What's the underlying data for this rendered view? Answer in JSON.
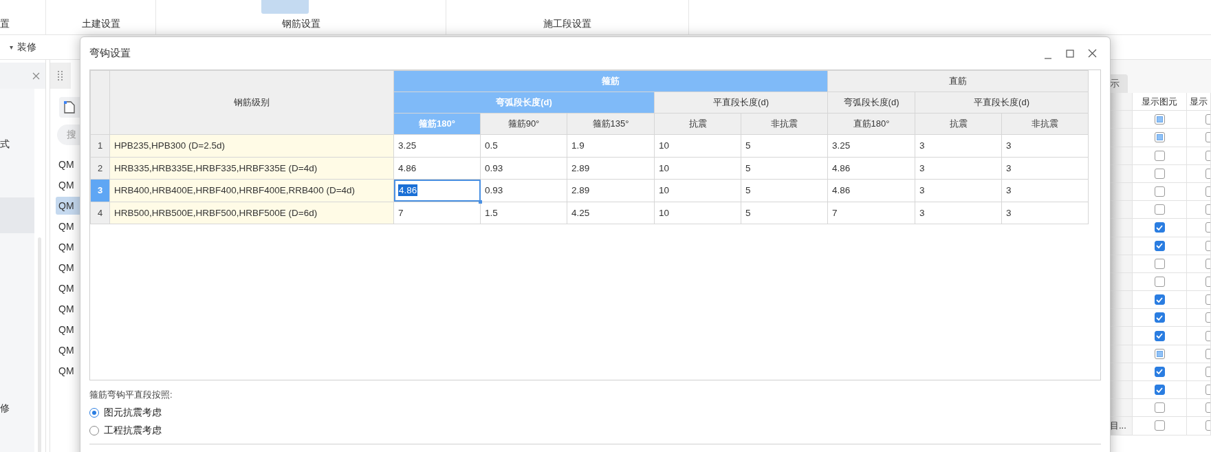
{
  "ribbon": {
    "groups": [
      {
        "label": "置"
      },
      {
        "label": "土建设置"
      },
      {
        "label": "钢筋设置"
      },
      {
        "label": "施工段设置"
      }
    ]
  },
  "toolbar": {
    "caret": "▾",
    "label": "装修"
  },
  "left_panel": {
    "items": [
      {
        "text": "式",
        "selected": false
      },
      {
        "selected": true
      },
      {
        "text": "修",
        "selected": false
      }
    ]
  },
  "list_panel": {
    "search": {
      "placeholder": "搜"
    },
    "items": [
      {
        "text": "QM",
        "selected": false
      },
      {
        "text": "QM",
        "selected": false
      },
      {
        "text": "QM",
        "selected": true
      },
      {
        "text": "QM",
        "selected": false
      },
      {
        "text": "QM",
        "selected": false
      },
      {
        "text": "QM",
        "selected": false
      },
      {
        "text": "QM",
        "selected": false
      },
      {
        "text": "QM",
        "selected": false
      },
      {
        "text": "QM",
        "selected": false
      },
      {
        "text": "QM",
        "selected": false
      },
      {
        "text": "QM",
        "selected": false
      }
    ]
  },
  "right_panel": {
    "tab": "示",
    "columns": [
      "显示图元",
      "显示"
    ],
    "rows": [
      {
        "checks": [
          {
            "checked": false,
            "partial": true
          },
          {
            "checked": false
          }
        ]
      },
      {
        "checks": [
          {
            "checked": false,
            "partial": true
          },
          {
            "checked": false
          }
        ]
      },
      {
        "checks": [
          {
            "checked": false
          },
          {
            "checked": false
          }
        ]
      },
      {
        "checks": [
          {
            "checked": false
          },
          {
            "checked": false
          }
        ]
      },
      {
        "checks": [
          {
            "checked": false
          },
          {
            "checked": false
          }
        ]
      },
      {
        "checks": [
          {
            "checked": false
          },
          {
            "checked": false
          }
        ]
      },
      {
        "checks": [
          {
            "checked": true
          },
          {
            "checked": false
          }
        ]
      },
      {
        "checks": [
          {
            "checked": true
          },
          {
            "checked": false
          }
        ]
      },
      {
        "checks": [
          {
            "checked": false
          },
          {
            "checked": false
          }
        ]
      },
      {
        "checks": [
          {
            "checked": false
          },
          {
            "checked": false
          }
        ]
      },
      {
        "checks": [
          {
            "checked": true
          },
          {
            "checked": false
          }
        ]
      },
      {
        "checks": [
          {
            "checked": true
          },
          {
            "checked": false
          }
        ]
      },
      {
        "checks": [
          {
            "checked": true
          },
          {
            "checked": false
          }
        ]
      },
      {
        "checks": [
          {
            "checked": false,
            "partial": true
          },
          {
            "checked": false
          }
        ]
      },
      {
        "checks": [
          {
            "checked": true
          },
          {
            "checked": false
          }
        ]
      },
      {
        "checks": [
          {
            "checked": true
          },
          {
            "checked": false
          }
        ]
      },
      {
        "checks": [
          {
            "checked": false
          },
          {
            "checked": false
          }
        ]
      },
      {
        "label": "目...",
        "checks": [
          {
            "checked": false
          },
          {
            "checked": false
          }
        ]
      }
    ]
  },
  "dialog": {
    "title": "弯钩设置",
    "table": {
      "grade_header": "钢筋级别",
      "groups": [
        {
          "label": "箍筋",
          "selected": true,
          "subgroups": [
            {
              "label": "弯弧段长度(d)",
              "selected": true,
              "columns": [
                {
                  "label": "箍筋180°",
                  "selected": true
                },
                {
                  "label": "箍筋90°",
                  "selected": false
                },
                {
                  "label": "箍筋135°",
                  "selected": false
                }
              ]
            },
            {
              "label": "平直段长度(d)",
              "selected": false,
              "columns": [
                {
                  "label": "抗震",
                  "selected": false
                },
                {
                  "label": "非抗震",
                  "selected": false
                }
              ]
            }
          ]
        },
        {
          "label": "直筋",
          "selected": false,
          "subgroups": [
            {
              "label": "弯弧段长度(d)",
              "selected": false,
              "columns": [
                {
                  "label": "直筋180°",
                  "selected": false
                }
              ]
            },
            {
              "label": "平直段长度(d)",
              "selected": false,
              "columns": [
                {
                  "label": "抗震",
                  "selected": false
                },
                {
                  "label": "非抗震",
                  "selected": false
                }
              ]
            }
          ]
        }
      ],
      "rows": [
        {
          "number": "1",
          "selected": false,
          "grade": "HPB235,HPB300 (D=2.5d)",
          "cells": [
            {
              "value": "3.25",
              "selected": false
            },
            {
              "value": "0.5",
              "selected": false
            },
            {
              "value": "1.9",
              "selected": false
            },
            {
              "value": "10",
              "selected": false
            },
            {
              "value": "5",
              "selected": false
            },
            {
              "value": "3.25",
              "selected": false
            },
            {
              "value": "3",
              "selected": false
            },
            {
              "value": "3",
              "selected": false
            }
          ]
        },
        {
          "number": "2",
          "selected": false,
          "grade": "HRB335,HRB335E,HRBF335,HRBF335E (D=4d)",
          "cells": [
            {
              "value": "4.86",
              "selected": false
            },
            {
              "value": "0.93",
              "selected": false
            },
            {
              "value": "2.89",
              "selected": false
            },
            {
              "value": "10",
              "selected": false
            },
            {
              "value": "5",
              "selected": false
            },
            {
              "value": "4.86",
              "selected": false
            },
            {
              "value": "3",
              "selected": false
            },
            {
              "value": "3",
              "selected": false
            }
          ]
        },
        {
          "number": "3",
          "selected": true,
          "grade": "HRB400,HRB400E,HRBF400,HRBF400E,RRB400 (D=4d)",
          "cells": [
            {
              "value": "4.86",
              "selected": true
            },
            {
              "value": "0.93",
              "selected": false
            },
            {
              "value": "2.89",
              "selected": false
            },
            {
              "value": "10",
              "selected": false
            },
            {
              "value": "5",
              "selected": false
            },
            {
              "value": "4.86",
              "selected": false
            },
            {
              "value": "3",
              "selected": false
            },
            {
              "value": "3",
              "selected": false
            }
          ]
        },
        {
          "number": "4",
          "selected": false,
          "grade": "HRB500,HRB500E,HRBF500,HRBF500E (D=6d)",
          "cells": [
            {
              "value": "7",
              "selected": false
            },
            {
              "value": "1.5",
              "selected": false
            },
            {
              "value": "4.25",
              "selected": false
            },
            {
              "value": "10",
              "selected": false
            },
            {
              "value": "5",
              "selected": false
            },
            {
              "value": "7",
              "selected": false
            },
            {
              "value": "3",
              "selected": false
            },
            {
              "value": "3",
              "selected": false
            }
          ]
        }
      ]
    },
    "option_label": "箍筋弯钩平直段按照:",
    "options": [
      {
        "label": "图元抗震考虑",
        "selected": true
      },
      {
        "label": "工程抗震考虑",
        "selected": false
      }
    ]
  }
}
